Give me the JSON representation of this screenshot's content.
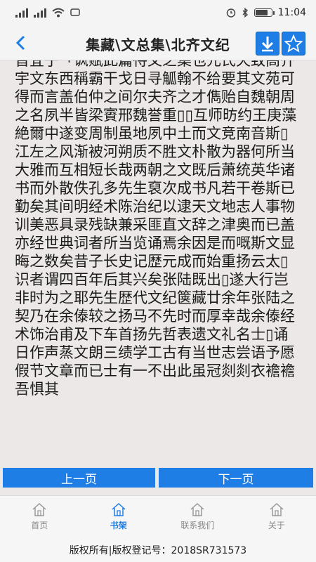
{
  "status_bar": {
    "time": "11:04"
  },
  "header": {
    "title": "集藏\\文总集\\北齐文纪"
  },
  "content": {
    "body_text": "晋宜子「讽赋此篇待文之集也元氏天致高齐宇文东西稱霸干戈日寻觚翰不给要其文苑可得而言盖伯仲之间尔夫齐之才儁贻自魏朝周之名夙半皆梁賨邢魏誉重▯▯互师昉约王庚藻絶爾中遂变周制虽地夙中土而文竞南音斯▯江左之风渐被河朔质不胜文朴散为器何所当大雅而互相短长哉两朝之文既后萧统英华诸书而外散佚孔多先生裒次成书凡若干卷斯已勤矣其间明经术陈治纪以逮天文地志人事物训美恶具录残缺兼采匪直文辞之津奥而已盖亦经世典词者所当览诵焉余因是而嘅斯文显晦之数矣昔子长史记歴元成而始重扬云太▯识者谓四百年后其兴矣张陆既出▯遂大行岂非时为之耶先生歴代文纪箧藏廿余年张陆之契乃在余傣较之扬马不先时而厚幸哉余傣经术饰治甫及下车首扬先哲表遗文礼名士▯诵日作声蒸文朗三绩学工古有当世志尝语予愿假节文章而已士有一不出此虽冠剡剡衣襜襜吾惧其"
  },
  "pager": {
    "prev_label": "上一页",
    "next_label": "下一页"
  },
  "nav": {
    "items": [
      {
        "label": "首页"
      },
      {
        "label": "书架"
      },
      {
        "label": "联系我们"
      },
      {
        "label": "关于"
      }
    ]
  },
  "footer": {
    "text": "版权所有|版权登记号：2018SR731573"
  },
  "colors": {
    "accent": "#1e7ee6",
    "reading_bg": "#ede8e8"
  },
  "icons": {
    "back": "chevron-left-icon",
    "download": "download-arrow-icon",
    "favorite": "star-icon",
    "home": "house-icon"
  }
}
